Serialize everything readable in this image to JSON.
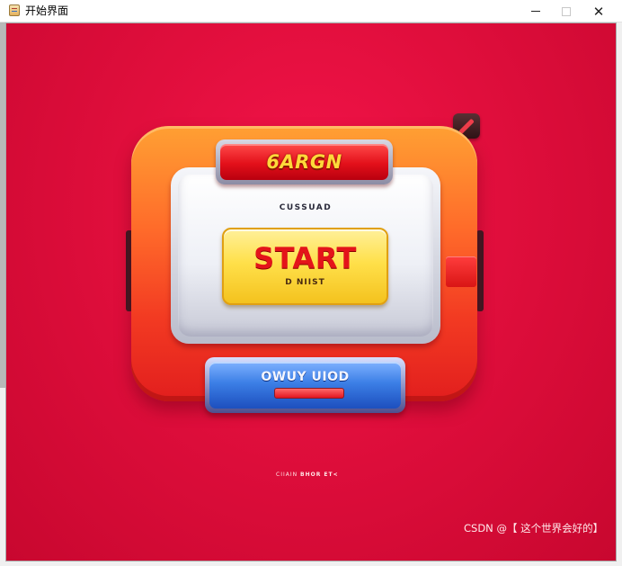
{
  "window": {
    "title": "开始界面",
    "icon": "java-app-icon",
    "controls": {
      "minimize": "",
      "maximize": "",
      "close": "✕"
    }
  },
  "game": {
    "header_label": "6ARGN",
    "screen_label": "CUSSUAD",
    "start_button": {
      "label": "START",
      "sublabel": "D NIIST"
    },
    "secondary_button": {
      "label": "OWUY UIOD"
    },
    "footer_caption_left": "CIIAIN",
    "footer_caption_right": "BHOR ET<",
    "colors": {
      "background": "#e00e3c",
      "frame": "#ff6a2a",
      "start_button": "#ffe04a",
      "start_text": "#e4141a",
      "secondary_button": "#3c7fe6",
      "header_text": "#ffd93a"
    }
  },
  "watermark": "CSDN @【 这个世界会好的】"
}
